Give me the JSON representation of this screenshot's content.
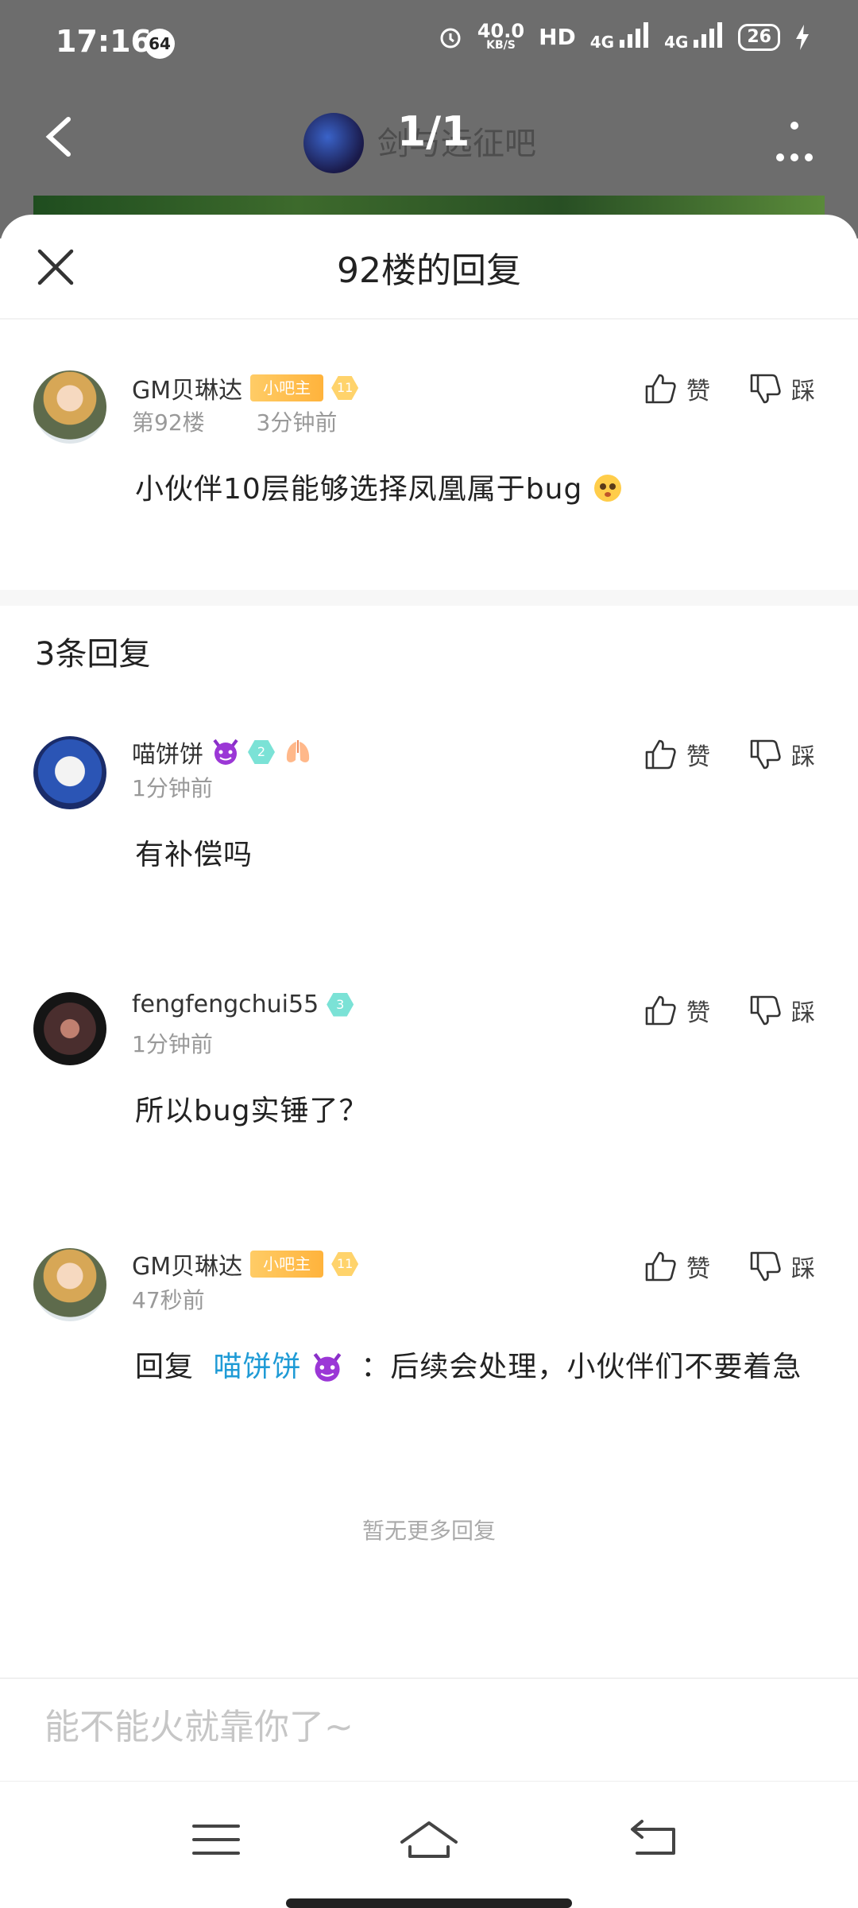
{
  "status_bar": {
    "time": "17:16",
    "badge": "64",
    "net_speed": "40.0",
    "net_unit": "KB/S",
    "hd": "HD",
    "sig1": "4G",
    "sig2": "4G",
    "battery": "26"
  },
  "page_header": {
    "forum_name": "剑与远征吧",
    "page_counter": "1/1"
  },
  "sheet": {
    "title": "92楼的回复"
  },
  "main_comment": {
    "username": "GM贝琳达",
    "tag": "小吧主",
    "level": "11",
    "floor": "第92楼",
    "time": "3分钟前",
    "content": "小伙伴10层能够选择凤凰属于bug",
    "like_label": "赞",
    "dislike_label": "踩"
  },
  "reply_count": "3条回复",
  "replies": [
    {
      "username": "喵饼饼",
      "level": "2",
      "time": "1分钟前",
      "content": "有补偿吗",
      "like_label": "赞",
      "dislike_label": "踩"
    },
    {
      "username": "fengfengchui55",
      "level": "3",
      "time": "1分钟前",
      "content": "所以bug实锤了？",
      "like_label": "赞",
      "dislike_label": "踩"
    },
    {
      "username": "GM贝琳达",
      "tag": "小吧主",
      "level": "11",
      "time": "47秒前",
      "reply_prefix": "回复",
      "mention": "喵饼饼",
      "content": "：后续会处理，小伙伴们不要着急",
      "like_label": "赞",
      "dislike_label": "踩"
    }
  ],
  "no_more": "暂无更多回复",
  "input": {
    "placeholder": "能不能火就靠你了~"
  }
}
